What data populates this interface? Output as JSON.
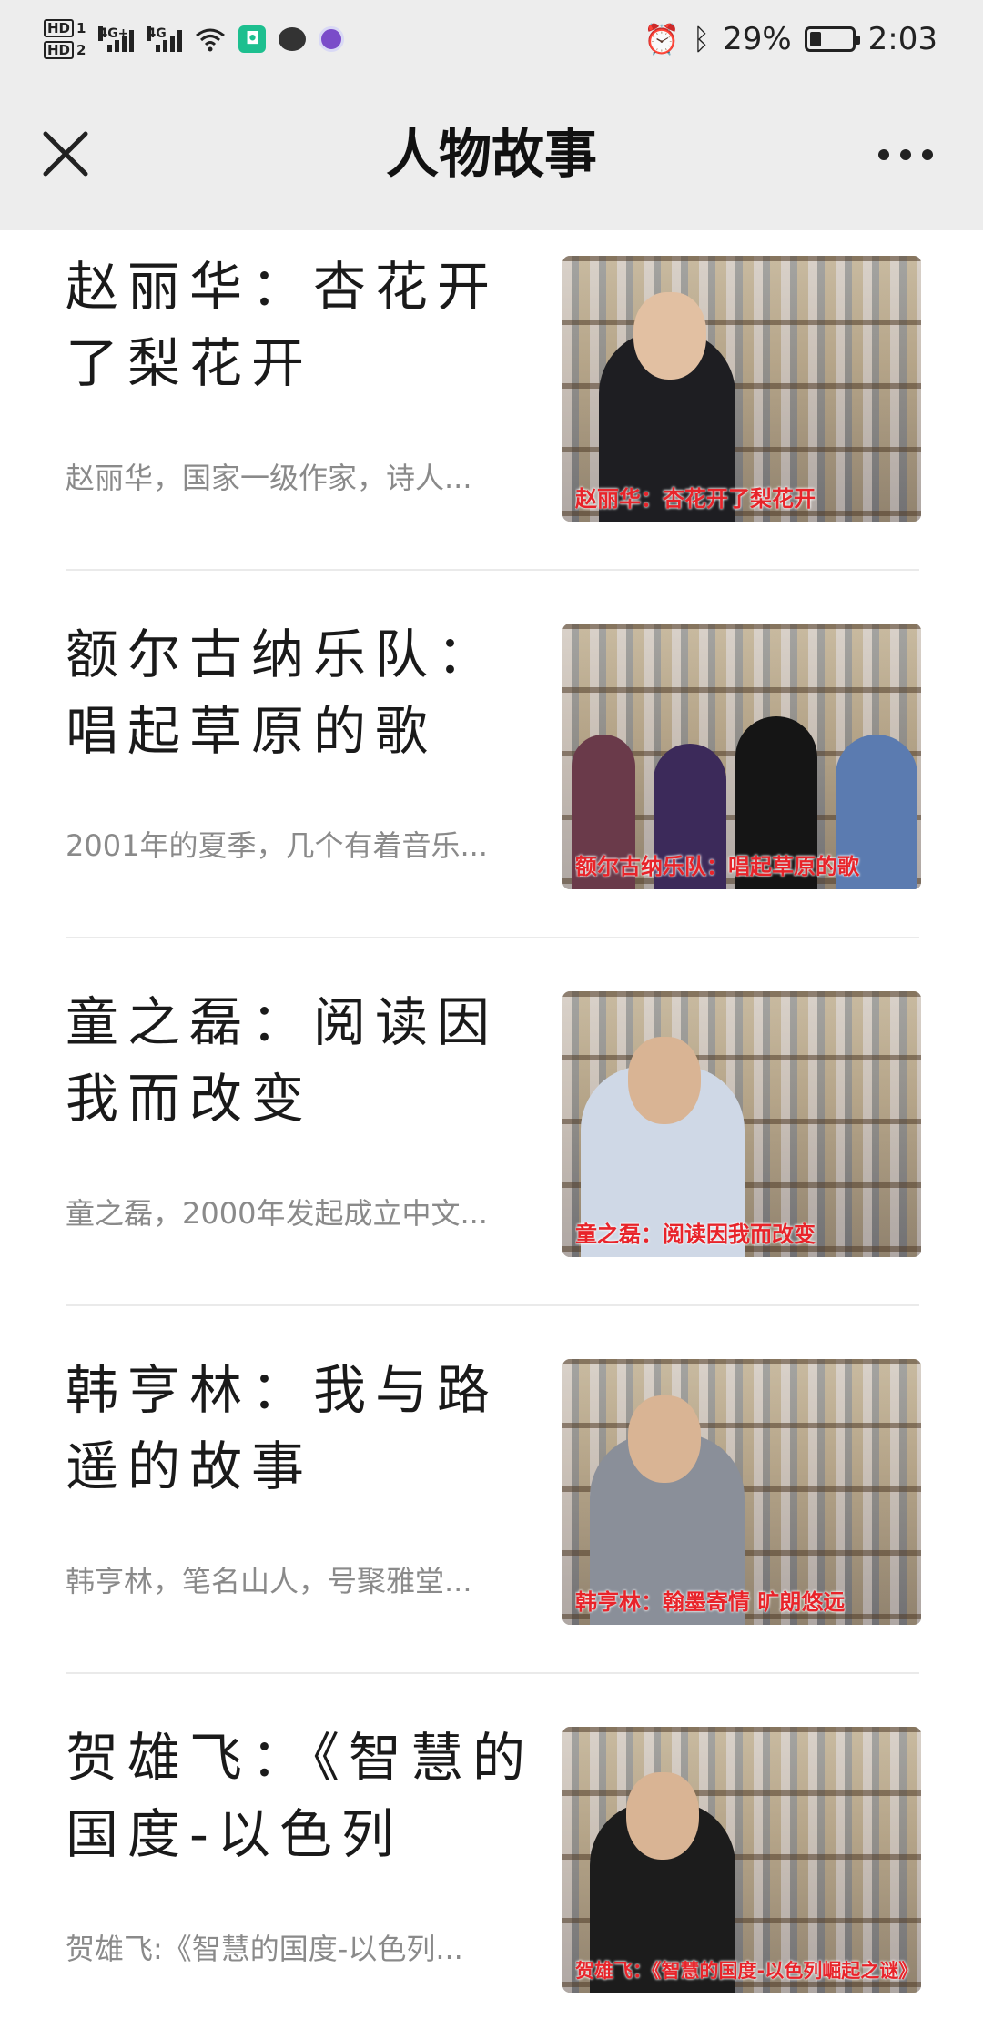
{
  "status_bar": {
    "hd1": "HD",
    "hd1_num": "1",
    "hd2": "HD",
    "hd2_num": "2",
    "net1": "4G+",
    "net2": "4G",
    "app_badge_icon": "mi-home-icon",
    "battery_percent": "29%",
    "battery_level": 0.29,
    "time": "2:03"
  },
  "nav": {
    "title": "人物故事",
    "close_icon": "close-icon",
    "more_icon": "more-icon"
  },
  "articles": [
    {
      "title": "赵丽华：杏花开了梨花开",
      "desc": "赵丽华，国家一级作家，诗人...",
      "caption": "赵丽华：杏花开了梨花开"
    },
    {
      "title": "额尔古纳乐队：唱起草原的歌",
      "desc": "2001年的夏季，几个有着音乐...",
      "caption": "额尔古纳乐队：唱起草原的歌"
    },
    {
      "title": "童之磊：阅读因我而改变",
      "desc": "童之磊，2000年发起成立中文...",
      "caption": "童之磊：阅读因我而改变"
    },
    {
      "title": "韩亨林：我与路遥的故事",
      "desc": "韩亨林，笔名山人，号聚雅堂...",
      "caption": "韩亨林：翰墨寄情  旷朗悠远"
    },
    {
      "title": "贺雄飞：《智慧的国度-以色列崛...",
      "desc": "贺雄飞:《智慧的国度-以色列...",
      "caption": "贺雄飞：《智慧的国度-以色列崛起之谜》"
    }
  ]
}
